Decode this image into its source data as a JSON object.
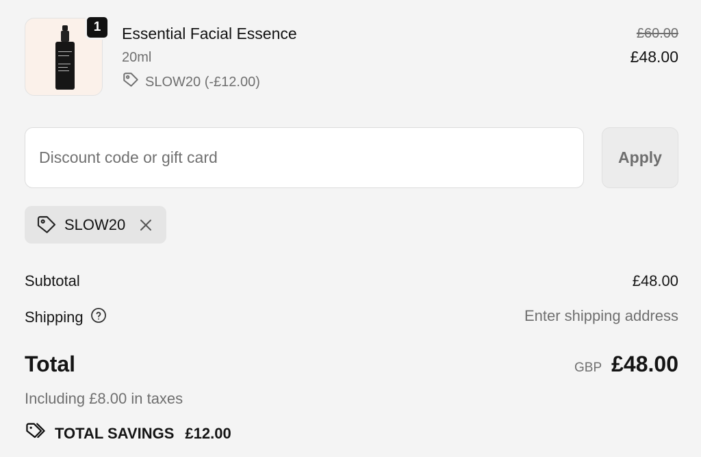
{
  "product": {
    "quantity": "1",
    "name": "Essential Facial Essence",
    "variant": "20ml",
    "discount_line": "SLOW20 (-£12.00)",
    "original_price": "£60.00",
    "price": "£48.00",
    "bottle_label": "Slow Aging Essential Facial Essence"
  },
  "discount": {
    "placeholder": "Discount code or gift card",
    "apply_label": "Apply",
    "applied_code": "SLOW20"
  },
  "summary": {
    "subtotal_label": "Subtotal",
    "subtotal_value": "£48.00",
    "shipping_label": "Shipping",
    "shipping_value": "Enter shipping address",
    "total_label": "Total",
    "currency": "GBP",
    "total_value": "£48.00",
    "tax_note": "Including £8.00 in taxes",
    "savings_label": "TOTAL SAVINGS",
    "savings_value": "£12.00"
  },
  "icons": {
    "tag": "tag-icon",
    "help": "question-circle-icon",
    "close": "close-icon",
    "savings": "double-tag-icon"
  },
  "colors": {
    "background": "#f4f4f4",
    "text": "#141414",
    "muted": "#6f6f6f",
    "badge": "#111111"
  }
}
